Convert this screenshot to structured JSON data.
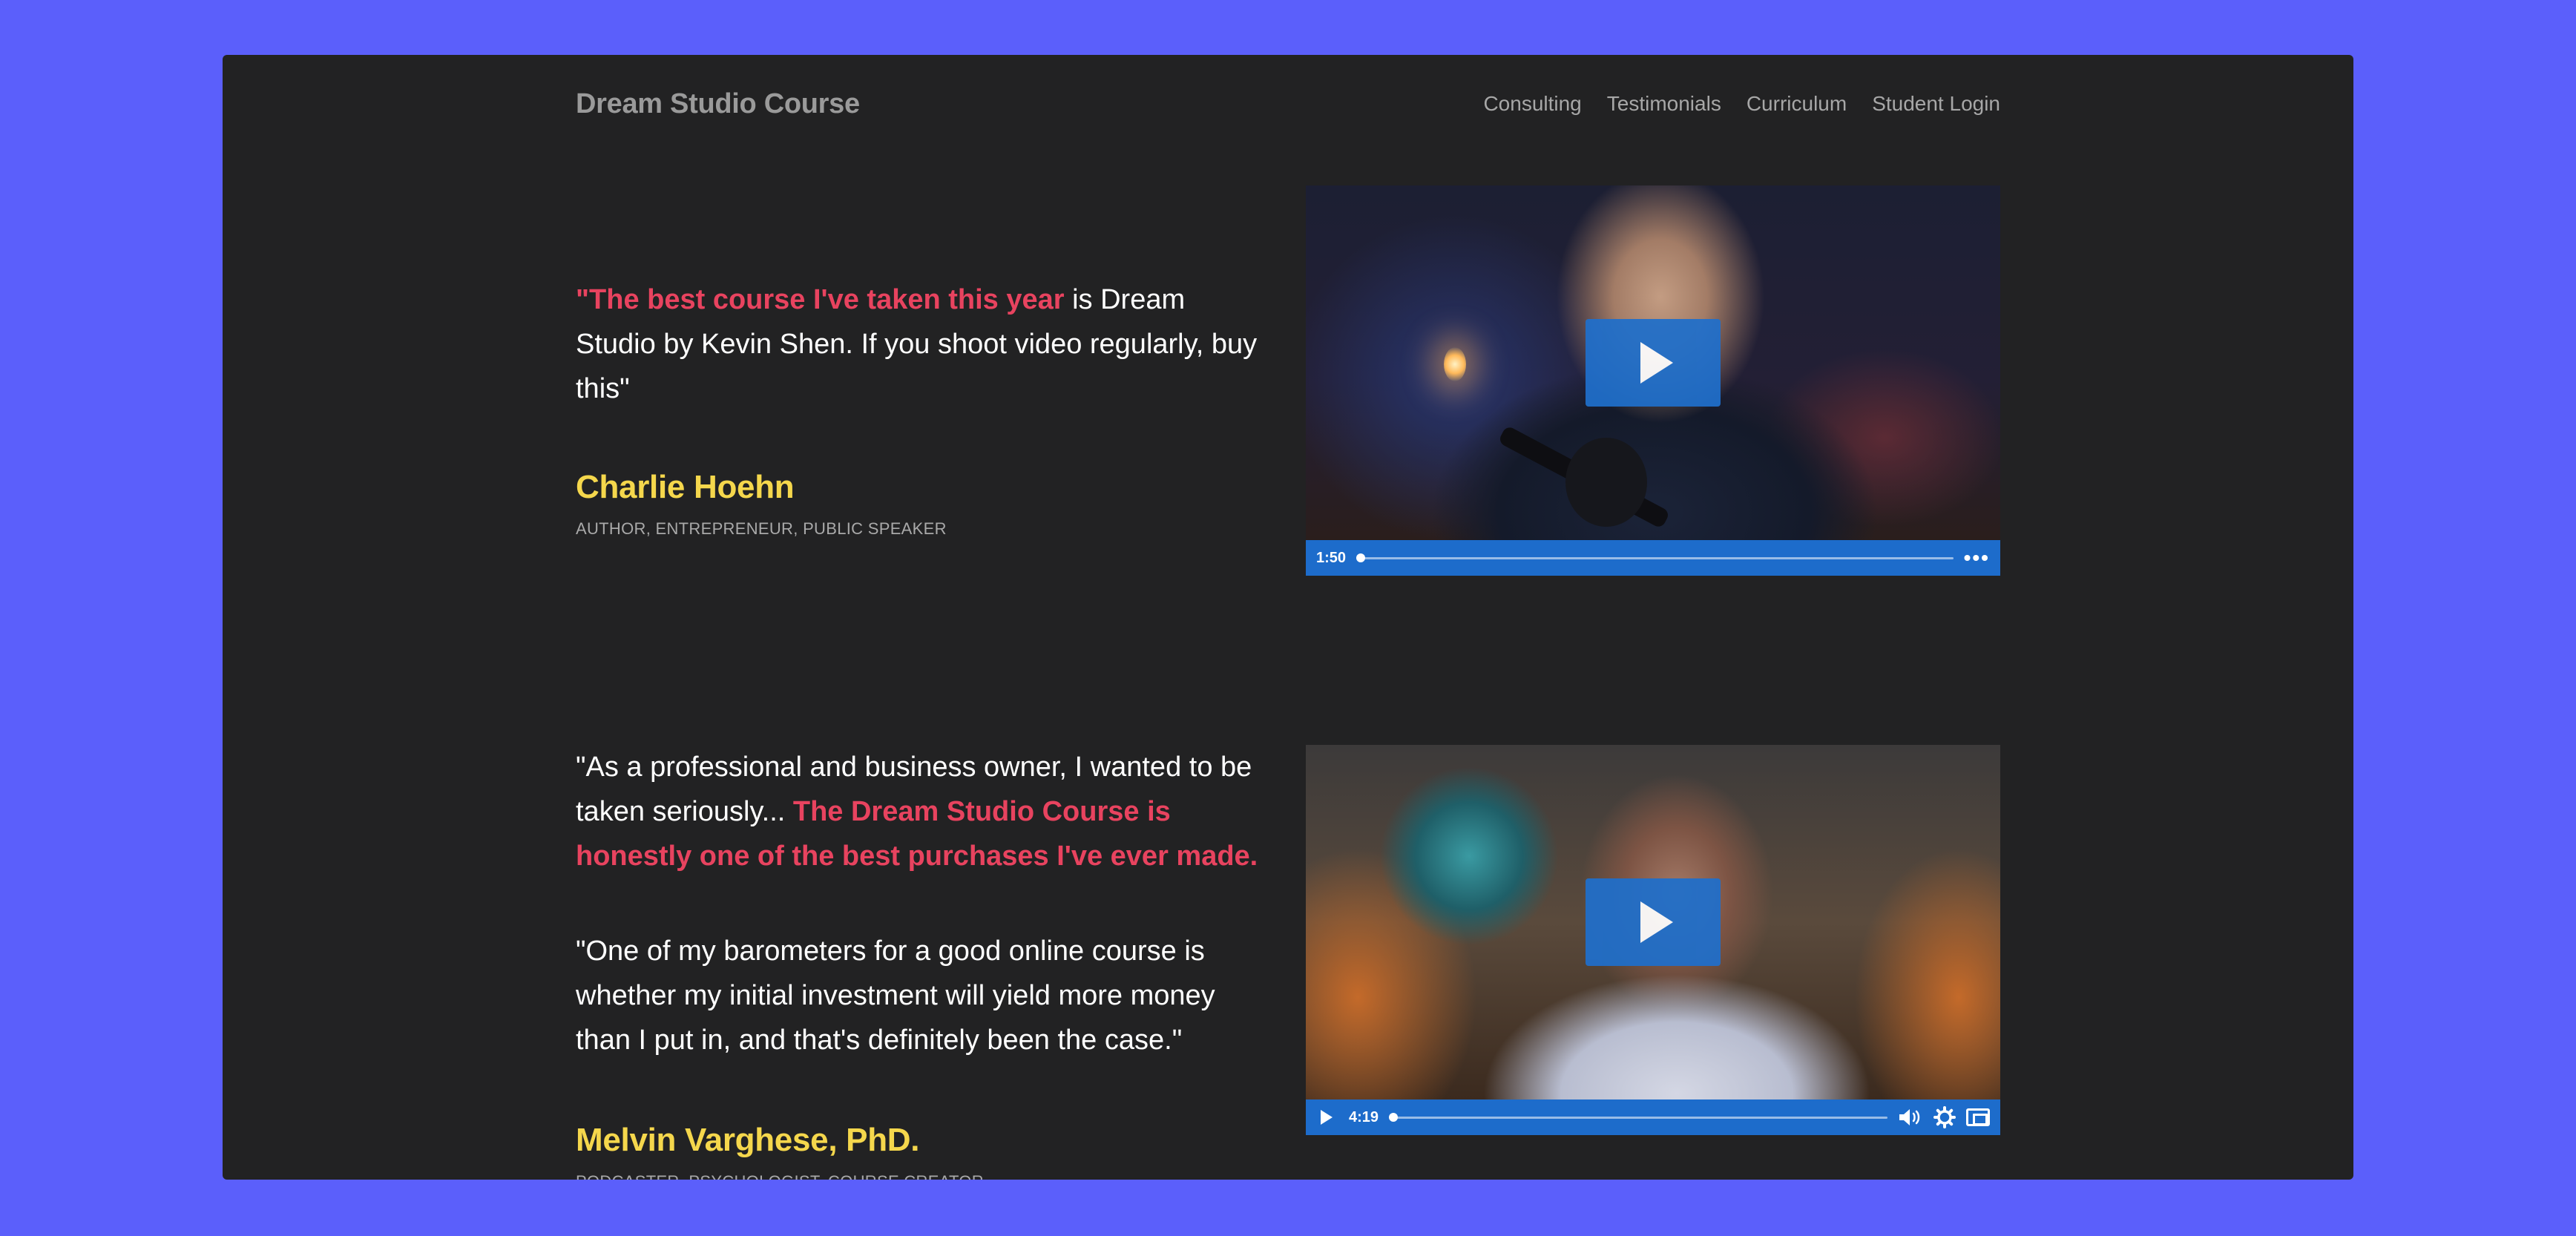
{
  "nav": {
    "brand": "Dream Studio Course",
    "links": [
      "Consulting",
      "Testimonials",
      "Curriculum",
      "Student Login"
    ]
  },
  "testimonials": [
    {
      "quote_highlight": "\"The best course I've taken this year",
      "quote_rest": " is Dream Studio by Kevin Shen. If you shoot video regularly, buy this\"",
      "name": "Charlie Hoehn",
      "role": "AUTHOR, ENTREPRENEUR, PUBLIC SPEAKER",
      "video": {
        "duration": "1:50",
        "progress": 0.0,
        "icons": [
          "play-icon",
          "more-options-icon"
        ]
      }
    },
    {
      "quote1_start": "\"As a professional and business owner, I wanted to be taken seriously... ",
      "quote1_highlight": "The Dream Studio Course is honestly one of the best purchases I've ever made.",
      "quote2": "\"One of my barometers for a good online course is whether my initial investment will yield more money than I put in, and that's definitely been the case.\"",
      "name": "Melvin Varghese, PhD.",
      "role": "PODCASTER, PSYCHOLOGIST, COURSE CREATOR",
      "video": {
        "duration": "4:19",
        "progress": 0.0,
        "icons": [
          "play-icon",
          "volume-icon",
          "settings-icon",
          "fullscreen-icon"
        ]
      }
    }
  ],
  "colors": {
    "page_background": "#5b5ffb",
    "panel": "#222223",
    "highlight_red": "#e8435f",
    "name_yellow": "#f5d74c",
    "player_blue": "#1d6ccb"
  }
}
